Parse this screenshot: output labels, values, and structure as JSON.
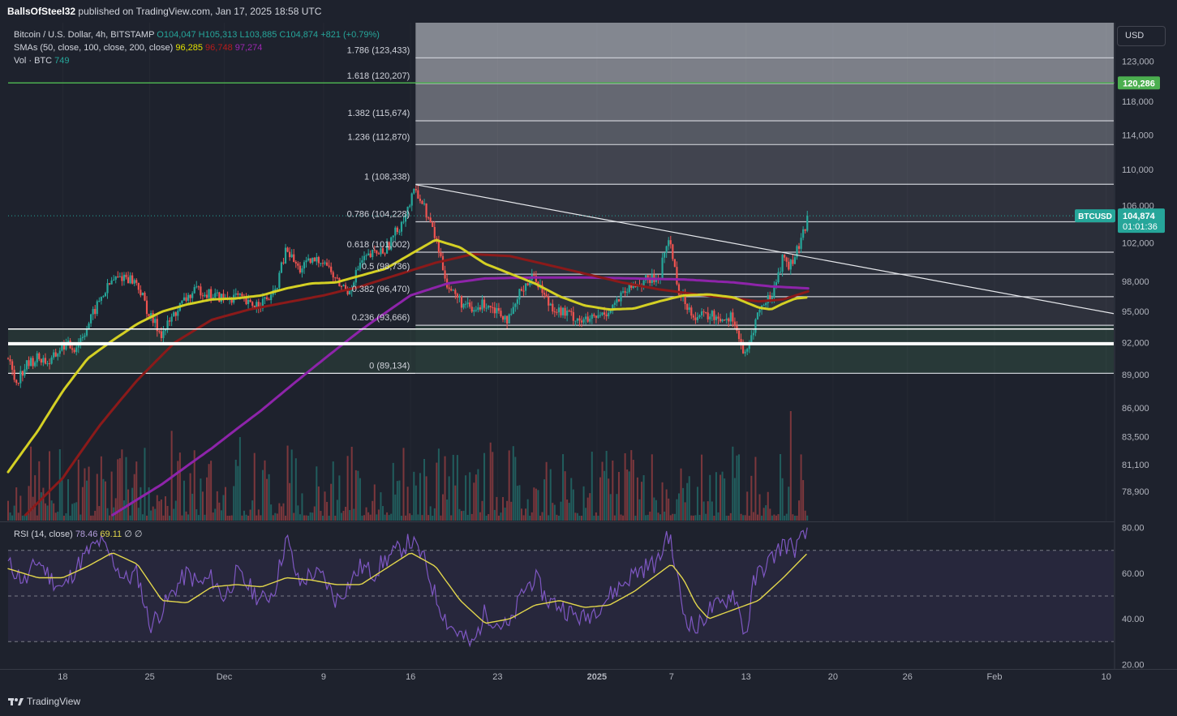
{
  "header": {
    "author": "BallsOfSteel32",
    "published_text": "published on TradingView.com, Jan 17, 2025 18:58 UTC"
  },
  "legend": {
    "symbol": "Bitcoin / U.S. Dollar, 4h, BITSTAMP",
    "open": "O104,047",
    "high": "H105,313",
    "low": "L103,885",
    "close": "C104,874",
    "change": "+821 (+0.79%)",
    "sma_label": "SMAs (50, close, 100, close, 200, close)",
    "sma50": "96,285",
    "sma100": "96,748",
    "sma200": "97,274",
    "vol_label": "Vol · BTC",
    "vol_value": "749"
  },
  "rsi_legend": {
    "label": "RSI (14, close)",
    "rsi": "78.46",
    "ma": "69.11",
    "d1": "∅",
    "d2": "∅"
  },
  "currency_button": "USD",
  "footer": {
    "brand": "TradingView"
  },
  "colors": {
    "up": "#26a69a",
    "down": "#ef5350",
    "sma50": "#d4d024",
    "sma100": "#8b1a1a",
    "sma200": "#8e24aa",
    "green_line": "#4caf50",
    "rsi_line": "#7e57c2",
    "rsi_ma": "#e2d64c"
  },
  "chart_data": [
    {
      "type": "candlestick",
      "title": "Bitcoin / U.S. Dollar, 4h, BITSTAMP",
      "ylim": [
        76500,
        128000
      ],
      "y_scale": "log",
      "y_ticks": [
        {
          "value": 123000,
          "label": "123,000"
        },
        {
          "value": 118000,
          "label": "118,000"
        },
        {
          "value": 114000,
          "label": "114,000"
        },
        {
          "value": 110000,
          "label": "110,000"
        },
        {
          "value": 106000,
          "label": "106,000"
        },
        {
          "value": 102000,
          "label": "102,000"
        },
        {
          "value": 98000,
          "label": "98,000"
        },
        {
          "value": 95000,
          "label": "95,000"
        },
        {
          "value": 92000,
          "label": "92,000"
        },
        {
          "value": 89000,
          "label": "89,000"
        },
        {
          "value": 86000,
          "label": "86,000"
        },
        {
          "value": 83500,
          "label": "83,500"
        },
        {
          "value": 81100,
          "label": "81,100"
        },
        {
          "value": 78900,
          "label": "78,900"
        }
      ],
      "x_ticks": [
        {
          "day": 18,
          "label": "18"
        },
        {
          "day": 25,
          "label": "25"
        },
        {
          "day": 31,
          "label": "Dec"
        },
        {
          "day": 39,
          "label": "9"
        },
        {
          "day": 46,
          "label": "16"
        },
        {
          "day": 53,
          "label": "23"
        },
        {
          "day": 61,
          "label": "2025"
        },
        {
          "day": 67,
          "label": "7"
        },
        {
          "day": 73,
          "label": "13"
        },
        {
          "day": 80,
          "label": "20"
        },
        {
          "day": 86,
          "label": "26"
        },
        {
          "day": 93,
          "label": "Feb"
        },
        {
          "day": 102,
          "label": "10"
        }
      ],
      "x_day_range": [
        13.6,
        102.6
      ],
      "price_points": [
        [
          13.6,
          90500
        ],
        [
          14.2,
          88300
        ],
        [
          15,
          89800
        ],
        [
          16,
          90600
        ],
        [
          17,
          90100
        ],
        [
          18,
          91800
        ],
        [
          19,
          91500
        ],
        [
          20,
          93600
        ],
        [
          21,
          96200
        ],
        [
          22,
          98100
        ],
        [
          23,
          98600
        ],
        [
          24,
          97800
        ],
        [
          25,
          94500
        ],
        [
          26,
          92800
        ],
        [
          27,
          94800
        ],
        [
          28,
          96400
        ],
        [
          29,
          97200
        ],
        [
          30,
          96600
        ],
        [
          31,
          96300
        ],
        [
          32,
          96500
        ],
        [
          33,
          95600
        ],
        [
          34,
          95900
        ],
        [
          35,
          96600
        ],
        [
          36,
          101300
        ],
        [
          37,
          99200
        ],
        [
          38,
          100000
        ],
        [
          39,
          100300
        ],
        [
          40,
          98000
        ],
        [
          41,
          97000
        ],
        [
          42,
          100000
        ],
        [
          43,
          100800
        ],
        [
          44,
          101300
        ],
        [
          45,
          103500
        ],
        [
          46,
          106300
        ],
        [
          46.4,
          107900
        ],
        [
          47,
          106100
        ],
        [
          48,
          102500
        ],
        [
          49,
          97500
        ],
        [
          50,
          96000
        ],
        [
          51,
          94900
        ],
        [
          52,
          95900
        ],
        [
          53,
          95200
        ],
        [
          54,
          94100
        ],
        [
          55,
          97500
        ],
        [
          56,
          98600
        ],
        [
          57,
          96000
        ],
        [
          58,
          95000
        ],
        [
          59,
          94600
        ],
        [
          60,
          94000
        ],
        [
          61,
          94400
        ],
        [
          62,
          95200
        ],
        [
          63,
          96500
        ],
        [
          64,
          97600
        ],
        [
          65,
          98100
        ],
        [
          66,
          98300
        ],
        [
          66.7,
          102500
        ],
        [
          67,
          101300
        ],
        [
          67.6,
          97000
        ],
        [
          68,
          96000
        ],
        [
          69,
          94500
        ],
        [
          70,
          94600
        ],
        [
          71,
          94400
        ],
        [
          72,
          94500
        ],
        [
          72.5,
          92000
        ],
        [
          73,
          90500
        ],
        [
          73.5,
          93000
        ],
        [
          74,
          95000
        ],
        [
          75,
          96500
        ],
        [
          75.6,
          98700
        ],
        [
          76,
          100600
        ],
        [
          76.5,
          99500
        ],
        [
          77,
          100800
        ],
        [
          77.5,
          102300
        ],
        [
          78,
          104874
        ]
      ],
      "sma50_points": [
        [
          13.6,
          80500
        ],
        [
          16,
          84000
        ],
        [
          18,
          87500
        ],
        [
          20,
          90500
        ],
        [
          22,
          92200
        ],
        [
          24,
          93800
        ],
        [
          26,
          95000
        ],
        [
          28,
          95700
        ],
        [
          30,
          96200
        ],
        [
          32,
          96300
        ],
        [
          34,
          96600
        ],
        [
          36,
          97300
        ],
        [
          38,
          97800
        ],
        [
          40,
          97900
        ],
        [
          42,
          98600
        ],
        [
          44,
          99300
        ],
        [
          46,
          100800
        ],
        [
          48,
          102300
        ],
        [
          50,
          101500
        ],
        [
          52,
          99800
        ],
        [
          54,
          98800
        ],
        [
          56,
          97800
        ],
        [
          58,
          96500
        ],
        [
          60,
          95600
        ],
        [
          62,
          95200
        ],
        [
          64,
          95300
        ],
        [
          66,
          96000
        ],
        [
          68,
          96600
        ],
        [
          70,
          96700
        ],
        [
          72,
          96400
        ],
        [
          74,
          95400
        ],
        [
          75,
          95200
        ],
        [
          76,
          95800
        ],
        [
          77,
          96300
        ],
        [
          78,
          96400
        ]
      ],
      "sma100_points": [
        [
          15,
          77000
        ],
        [
          18,
          80000
        ],
        [
          21,
          84500
        ],
        [
          24,
          88500
        ],
        [
          27,
          92000
        ],
        [
          30,
          94200
        ],
        [
          33,
          95200
        ],
        [
          36,
          95900
        ],
        [
          39,
          96600
        ],
        [
          42,
          97500
        ],
        [
          45,
          98700
        ],
        [
          48,
          99900
        ],
        [
          51,
          100800
        ],
        [
          54,
          100600
        ],
        [
          57,
          99700
        ],
        [
          60,
          98800
        ],
        [
          63,
          97900
        ],
        [
          66,
          97200
        ],
        [
          69,
          96700
        ],
        [
          72,
          96300
        ],
        [
          74,
          96000
        ],
        [
          76,
          96200
        ],
        [
          78,
          97000
        ]
      ],
      "sma200_points": [
        [
          22,
          77000
        ],
        [
          26,
          79500
        ],
        [
          30,
          82500
        ],
        [
          34,
          85800
        ],
        [
          38,
          89500
        ],
        [
          42,
          93200
        ],
        [
          46,
          96600
        ],
        [
          49,
          97800
        ],
        [
          52,
          98300
        ],
        [
          56,
          98400
        ],
        [
          60,
          98400
        ],
        [
          64,
          98300
        ],
        [
          68,
          98200
        ],
        [
          72,
          97900
        ],
        [
          75,
          97500
        ],
        [
          78,
          97300
        ]
      ],
      "fib_levels": [
        {
          "ratio": "0",
          "price": 89134,
          "label": "0 (89,134)"
        },
        {
          "ratio": "0.236",
          "price": 93666,
          "label": "0.236 (93,666)"
        },
        {
          "ratio": "0.382",
          "price": 96470,
          "label": "0.382 (96,470)"
        },
        {
          "ratio": "0.5",
          "price": 98736,
          "label": "0.5 (98,736)"
        },
        {
          "ratio": "0.618",
          "price": 101002,
          "label": "0.618 (101,002)"
        },
        {
          "ratio": "0.786",
          "price": 104228,
          "label": "0.786 (104,228)"
        },
        {
          "ratio": "1",
          "price": 108338,
          "label": "1 (108,338)"
        },
        {
          "ratio": "1.236",
          "price": 112870,
          "label": "1.236 (112,870)"
        },
        {
          "ratio": "1.382",
          "price": 115674,
          "label": "1.382 (115,674)"
        },
        {
          "ratio": "1.618",
          "price": 120207,
          "label": "1.618 (120,207)"
        },
        {
          "ratio": "1.786",
          "price": 123433,
          "label": "1.786 (123,433)"
        }
      ],
      "fib_start_day": 46.4,
      "support_lines": [
        93300,
        91900
      ],
      "green_line": {
        "price": 120286,
        "label": "120,286"
      },
      "trendline": {
        "start": [
          46.4,
          108300
        ],
        "end": [
          102.6,
          94800
        ]
      },
      "last_price": {
        "symbol": "BTCUSD",
        "value": "104,874",
        "timer": "01:01:36",
        "price": 104874
      }
    },
    {
      "type": "line",
      "title": "RSI (14, close)",
      "ylim": [
        18,
        82
      ],
      "y_ticks": [
        {
          "value": 80,
          "label": "80.00"
        },
        {
          "value": 60,
          "label": "60.00"
        },
        {
          "value": 40,
          "label": "40.00"
        },
        {
          "value": 20,
          "label": "20.00"
        }
      ],
      "bands": [
        70,
        50,
        30
      ],
      "rsi_points": [
        [
          13.6,
          64
        ],
        [
          15,
          56
        ],
        [
          16,
          66
        ],
        [
          17,
          58
        ],
        [
          18,
          53
        ],
        [
          19,
          62
        ],
        [
          20,
          69
        ],
        [
          21,
          74
        ],
        [
          22,
          66
        ],
        [
          23,
          57
        ],
        [
          24,
          60
        ],
        [
          25,
          37
        ],
        [
          26,
          44
        ],
        [
          27,
          53
        ],
        [
          28,
          60
        ],
        [
          29,
          55
        ],
        [
          30,
          58
        ],
        [
          31,
          49
        ],
        [
          32,
          60
        ],
        [
          33,
          54
        ],
        [
          34,
          48
        ],
        [
          35,
          52
        ],
        [
          36,
          76
        ],
        [
          37,
          55
        ],
        [
          38,
          60
        ],
        [
          39,
          58
        ],
        [
          40,
          48
        ],
        [
          41,
          55
        ],
        [
          42,
          63
        ],
        [
          43,
          60
        ],
        [
          44,
          66
        ],
        [
          45,
          70
        ],
        [
          46,
          74
        ],
        [
          47,
          67
        ],
        [
          48,
          50
        ],
        [
          49,
          38
        ],
        [
          50,
          33
        ],
        [
          51,
          28
        ],
        [
          52,
          43
        ],
        [
          53,
          38
        ],
        [
          54,
          36
        ],
        [
          55,
          52
        ],
        [
          56,
          58
        ],
        [
          57,
          48
        ],
        [
          58,
          46
        ],
        [
          59,
          42
        ],
        [
          60,
          40
        ],
        [
          61,
          45
        ],
        [
          62,
          50
        ],
        [
          63,
          55
        ],
        [
          64,
          60
        ],
        [
          65,
          63
        ],
        [
          66,
          65
        ],
        [
          66.7,
          79
        ],
        [
          67.3,
          63
        ],
        [
          68,
          42
        ],
        [
          69,
          35
        ],
        [
          70,
          44
        ],
        [
          71,
          46
        ],
        [
          72,
          52
        ],
        [
          72.6,
          40
        ],
        [
          73,
          32
        ],
        [
          73.6,
          55
        ],
        [
          74,
          60
        ],
        [
          75,
          66
        ],
        [
          76,
          73
        ],
        [
          77,
          71
        ],
        [
          78,
          78.46
        ]
      ],
      "rsi_ma_points": [
        [
          13.6,
          62
        ],
        [
          16,
          58
        ],
        [
          18,
          58
        ],
        [
          20,
          63
        ],
        [
          22,
          69
        ],
        [
          24,
          64
        ],
        [
          26,
          48
        ],
        [
          28,
          47
        ],
        [
          30,
          54
        ],
        [
          32,
          55
        ],
        [
          34,
          54
        ],
        [
          36,
          58
        ],
        [
          38,
          57
        ],
        [
          40,
          55
        ],
        [
          42,
          55
        ],
        [
          44,
          62
        ],
        [
          46,
          69
        ],
        [
          48,
          63
        ],
        [
          50,
          48
        ],
        [
          52,
          38
        ],
        [
          54,
          40
        ],
        [
          56,
          46
        ],
        [
          58,
          48
        ],
        [
          60,
          45
        ],
        [
          62,
          46
        ],
        [
          64,
          52
        ],
        [
          66,
          60
        ],
        [
          67,
          64
        ],
        [
          68,
          57
        ],
        [
          69,
          46
        ],
        [
          70,
          40
        ],
        [
          72,
          44
        ],
        [
          74,
          48
        ],
        [
          76,
          58
        ],
        [
          78,
          69.11
        ]
      ]
    }
  ]
}
